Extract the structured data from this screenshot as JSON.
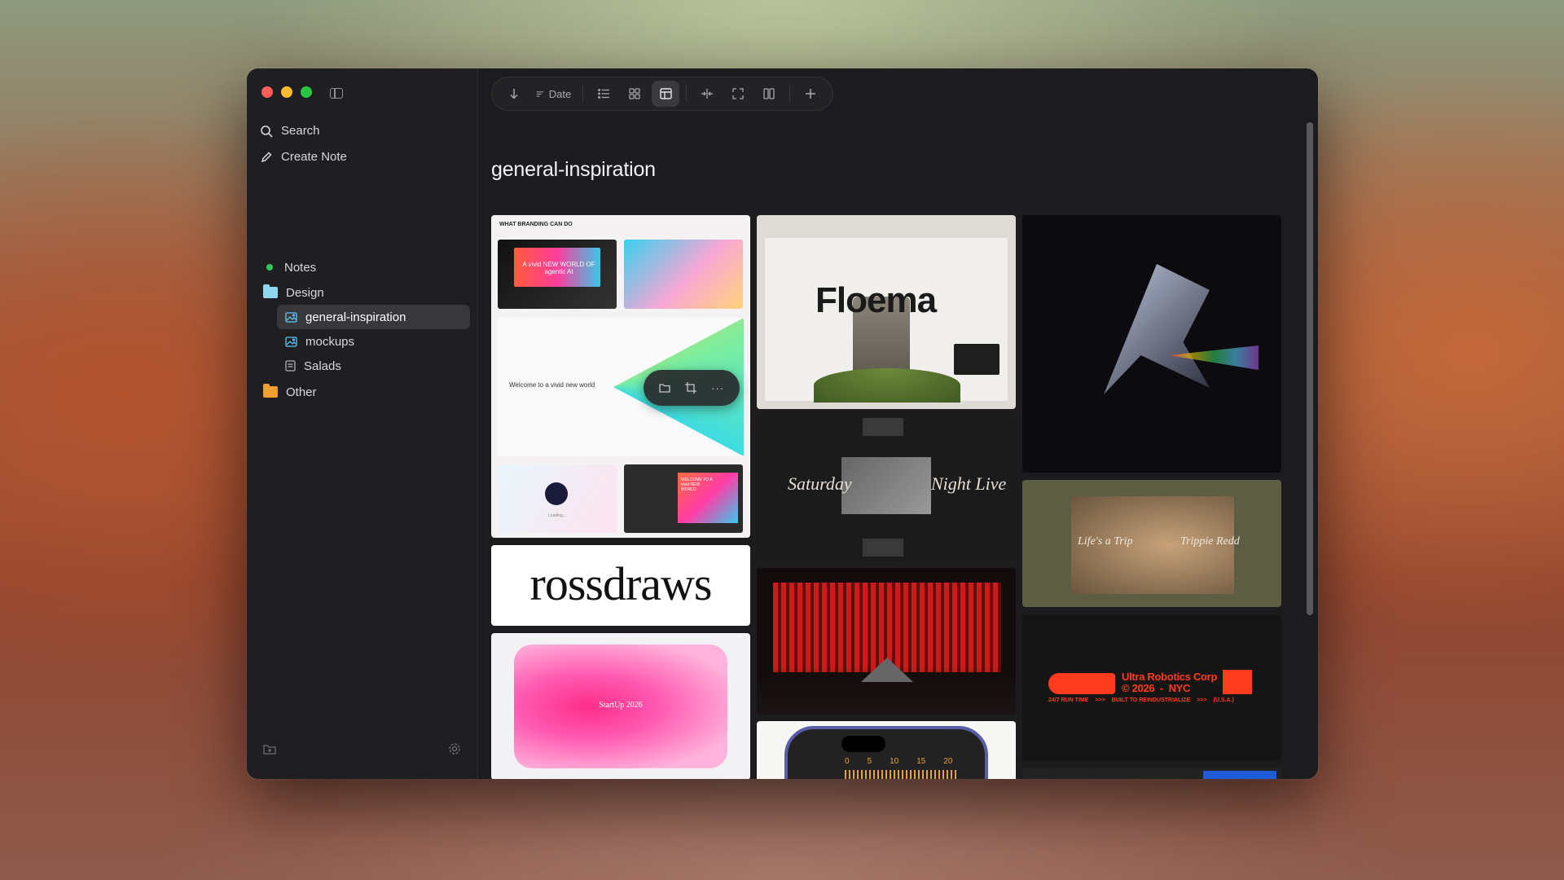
{
  "sidebar": {
    "search_label": "Search",
    "create_note_label": "Create Note",
    "notes_label": "Notes",
    "folders": [
      {
        "label": "Design"
      },
      {
        "label": "general-inspiration"
      },
      {
        "label": "mockups"
      },
      {
        "label": "Salads"
      },
      {
        "label": "Other"
      }
    ]
  },
  "toolbar": {
    "sort_label": "Date"
  },
  "main": {
    "title": "general-inspiration",
    "cards": {
      "branding_header": "WHAT BRANDING CAN DO",
      "vivid_headline": "A vivid NEW WORLD OF agentic AI",
      "welcome_text": "Welcome to a vivid new world",
      "welcome_box": "WELCOME TO A vivid NEW WORLD",
      "loading_text": "Loading...",
      "rossdraws": "rossdraws",
      "startup": "StartUp 2026",
      "floema": "Floema",
      "saturday": "Saturday",
      "night_live": "Night Live",
      "lifes_a_trip": "Life's a Trip",
      "trippie_redd": "Trippie Redd",
      "ultra_title": "Ultra Robotics Corp",
      "ultra_year": "© 2026",
      "ultra_city": "NYC",
      "ultra_tag1": "24/7 RUN TIME",
      "ultra_tag2": "BUILT TO REINDUSTRIALIZE",
      "ultra_tag3": "(U.S.A.)",
      "dial_ticks": [
        "0",
        "5",
        "10",
        "15",
        "20"
      ]
    }
  }
}
